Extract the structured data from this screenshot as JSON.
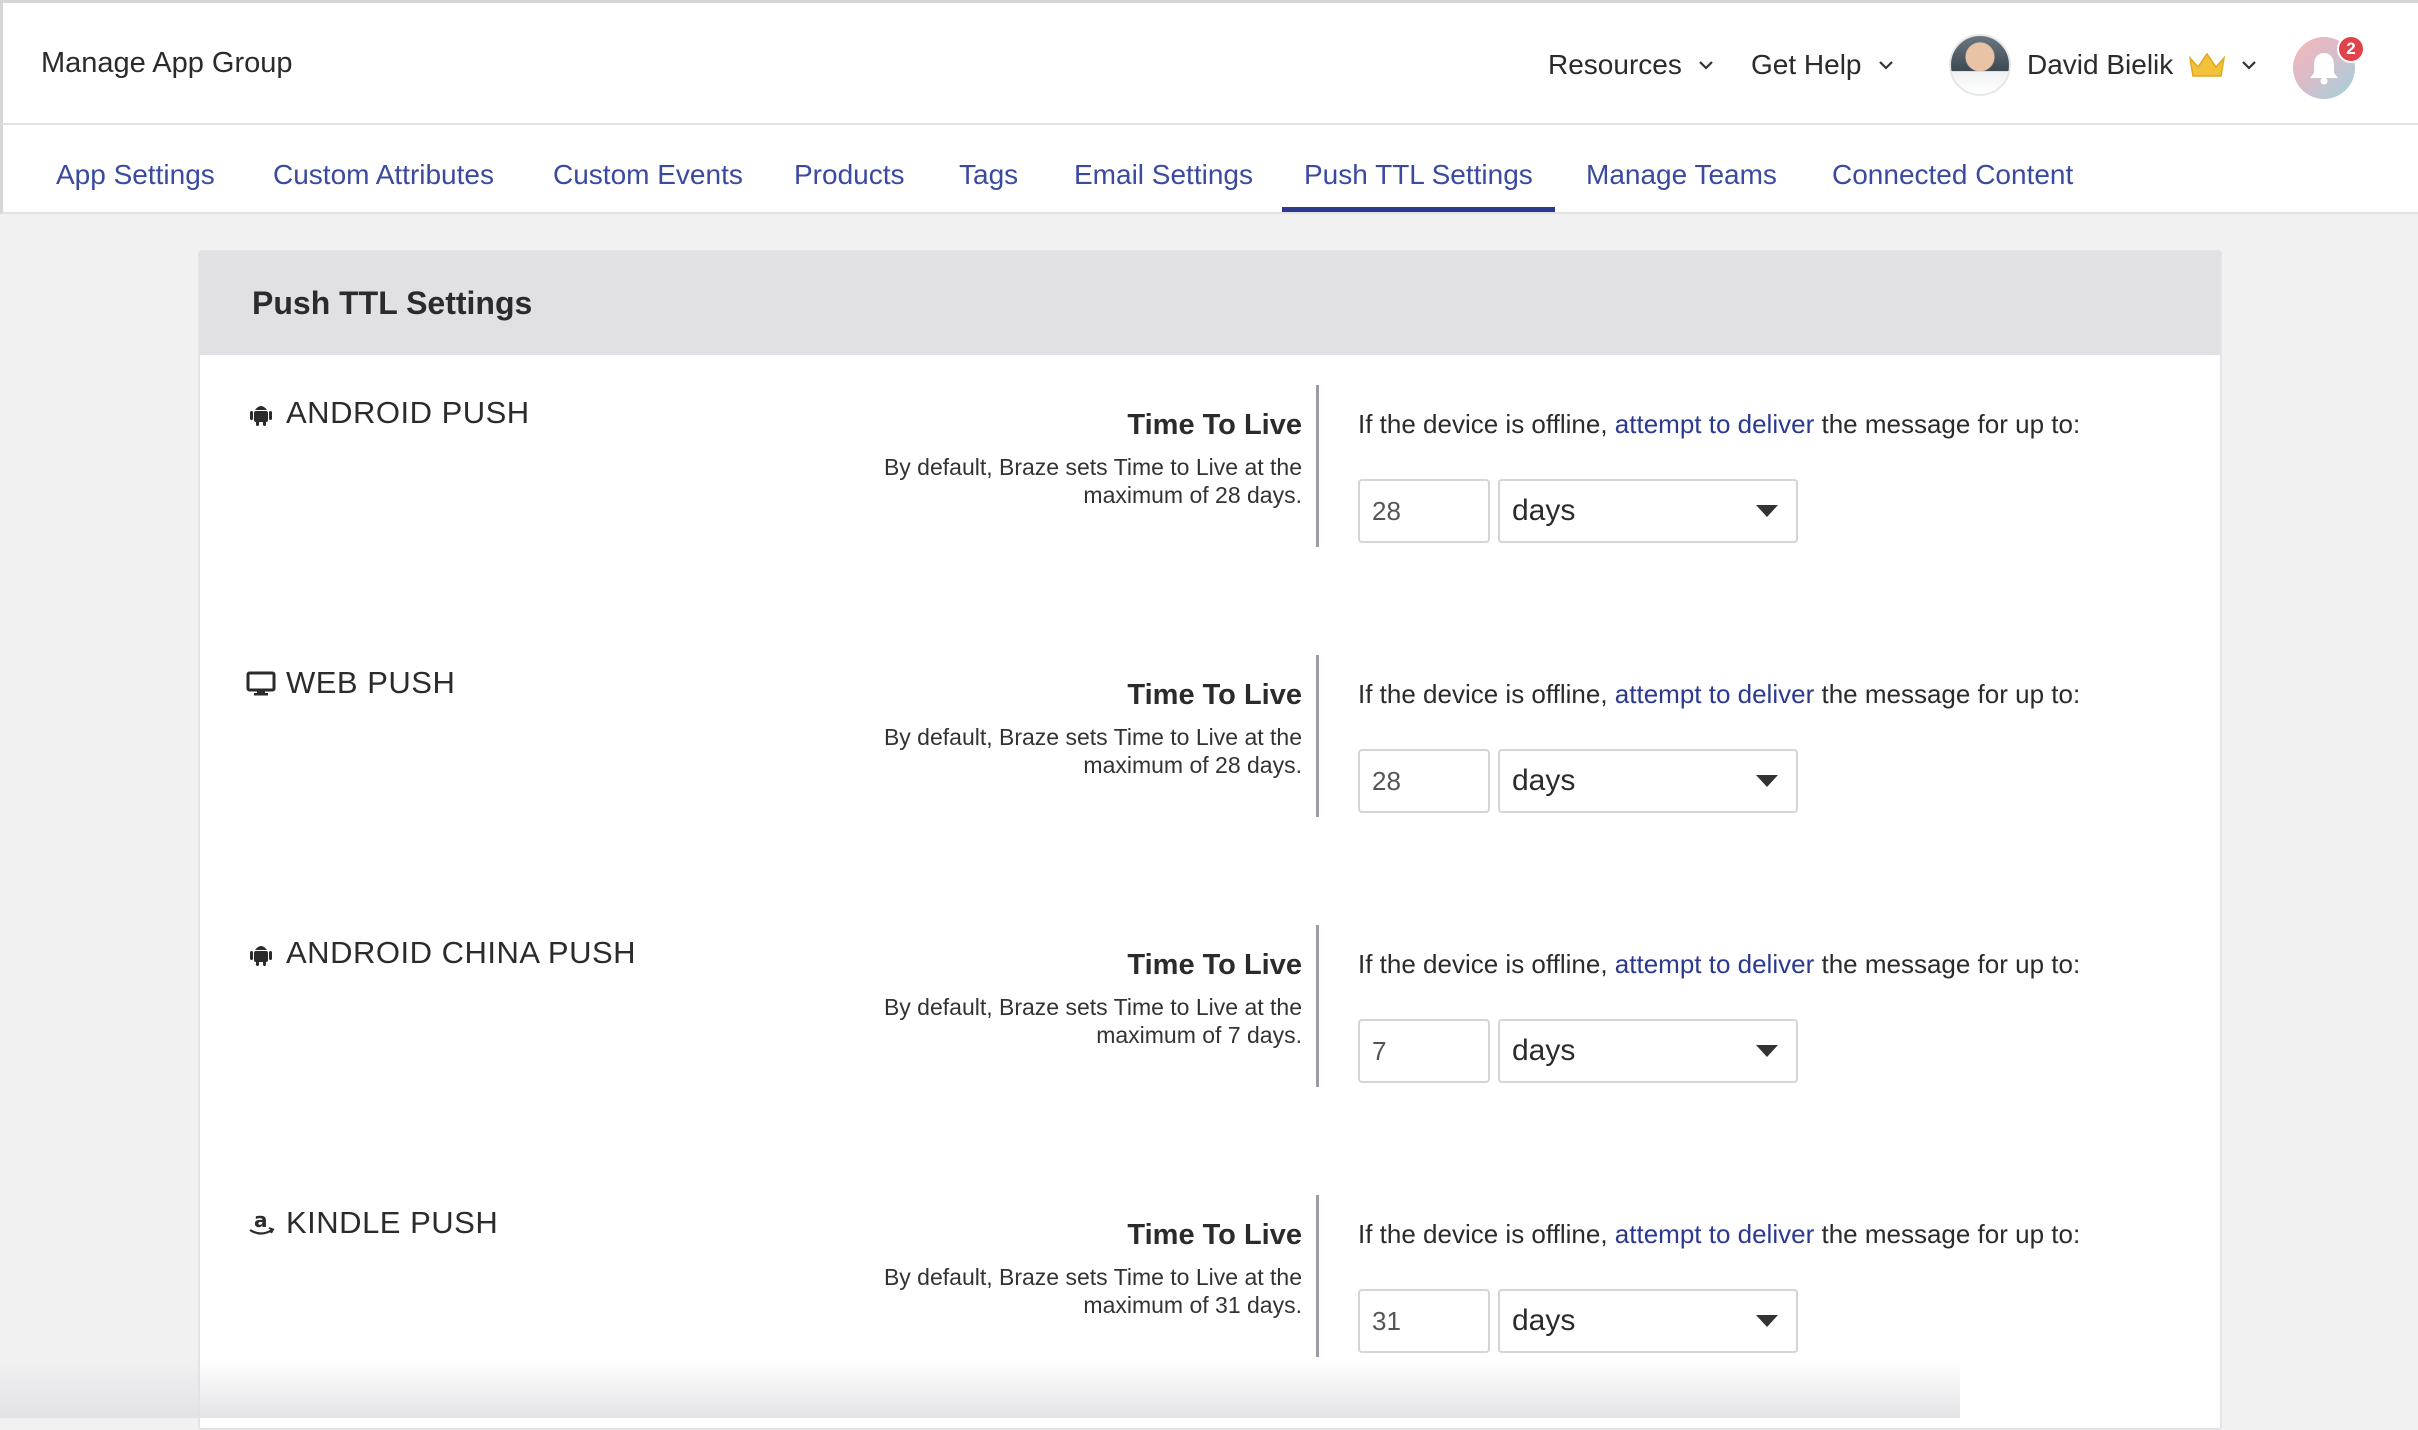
{
  "header": {
    "title": "Manage App Group",
    "nav": [
      {
        "label": "Resources"
      },
      {
        "label": "Get Help"
      }
    ],
    "user": {
      "name": "David Bielik"
    },
    "notifications": {
      "count": "2"
    }
  },
  "tabs": [
    {
      "label": "App Settings"
    },
    {
      "label": "Custom Attributes"
    },
    {
      "label": "Custom Events"
    },
    {
      "label": "Products"
    },
    {
      "label": "Tags"
    },
    {
      "label": "Email Settings"
    },
    {
      "label": "Push TTL Settings",
      "active": true
    },
    {
      "label": "Manage Teams"
    },
    {
      "label": "Connected Content"
    }
  ],
  "card": {
    "title": "Push TTL Settings",
    "sections": [
      {
        "platform": "ANDROID PUSH",
        "icon": "android-icon",
        "ttl_title": "Time To Live",
        "ttl_desc": "By default, Braze sets Time to Live at the maximum of 28 days.",
        "offline_prefix": "If the device is offline,",
        "offline_link": "attempt to deliver",
        "offline_suffix": "the message for up to:",
        "value": "28",
        "unit": "days"
      },
      {
        "platform": "WEB PUSH",
        "icon": "desktop-icon",
        "ttl_title": "Time To Live",
        "ttl_desc": "By default, Braze sets Time to Live at the maximum of 28 days.",
        "offline_prefix": "If the device is offline,",
        "offline_link": "attempt to deliver",
        "offline_suffix": "the message for up to:",
        "value": "28",
        "unit": "days"
      },
      {
        "platform": "ANDROID CHINA PUSH",
        "icon": "android-icon",
        "ttl_title": "Time To Live",
        "ttl_desc": "By default, Braze sets Time to Live at the maximum of 7 days.",
        "offline_prefix": "If the device is offline,",
        "offline_link": "attempt to deliver",
        "offline_suffix": "the message for up to:",
        "value": "7",
        "unit": "days"
      },
      {
        "platform": "KINDLE PUSH",
        "icon": "amazon-icon",
        "ttl_title": "Time To Live",
        "ttl_desc": "By default, Braze sets Time to Live at the maximum of 31 days.",
        "offline_prefix": "If the device is offline,",
        "offline_link": "attempt to deliver",
        "offline_suffix": "the message for up to:",
        "value": "31",
        "unit": "days"
      }
    ]
  },
  "colors": {
    "accent": "#2b3a8f",
    "tab_text": "#3a4a9f",
    "card_header_bg": "#e0e0e5",
    "badge": "#e0434a",
    "crown": "#f2c23a"
  }
}
